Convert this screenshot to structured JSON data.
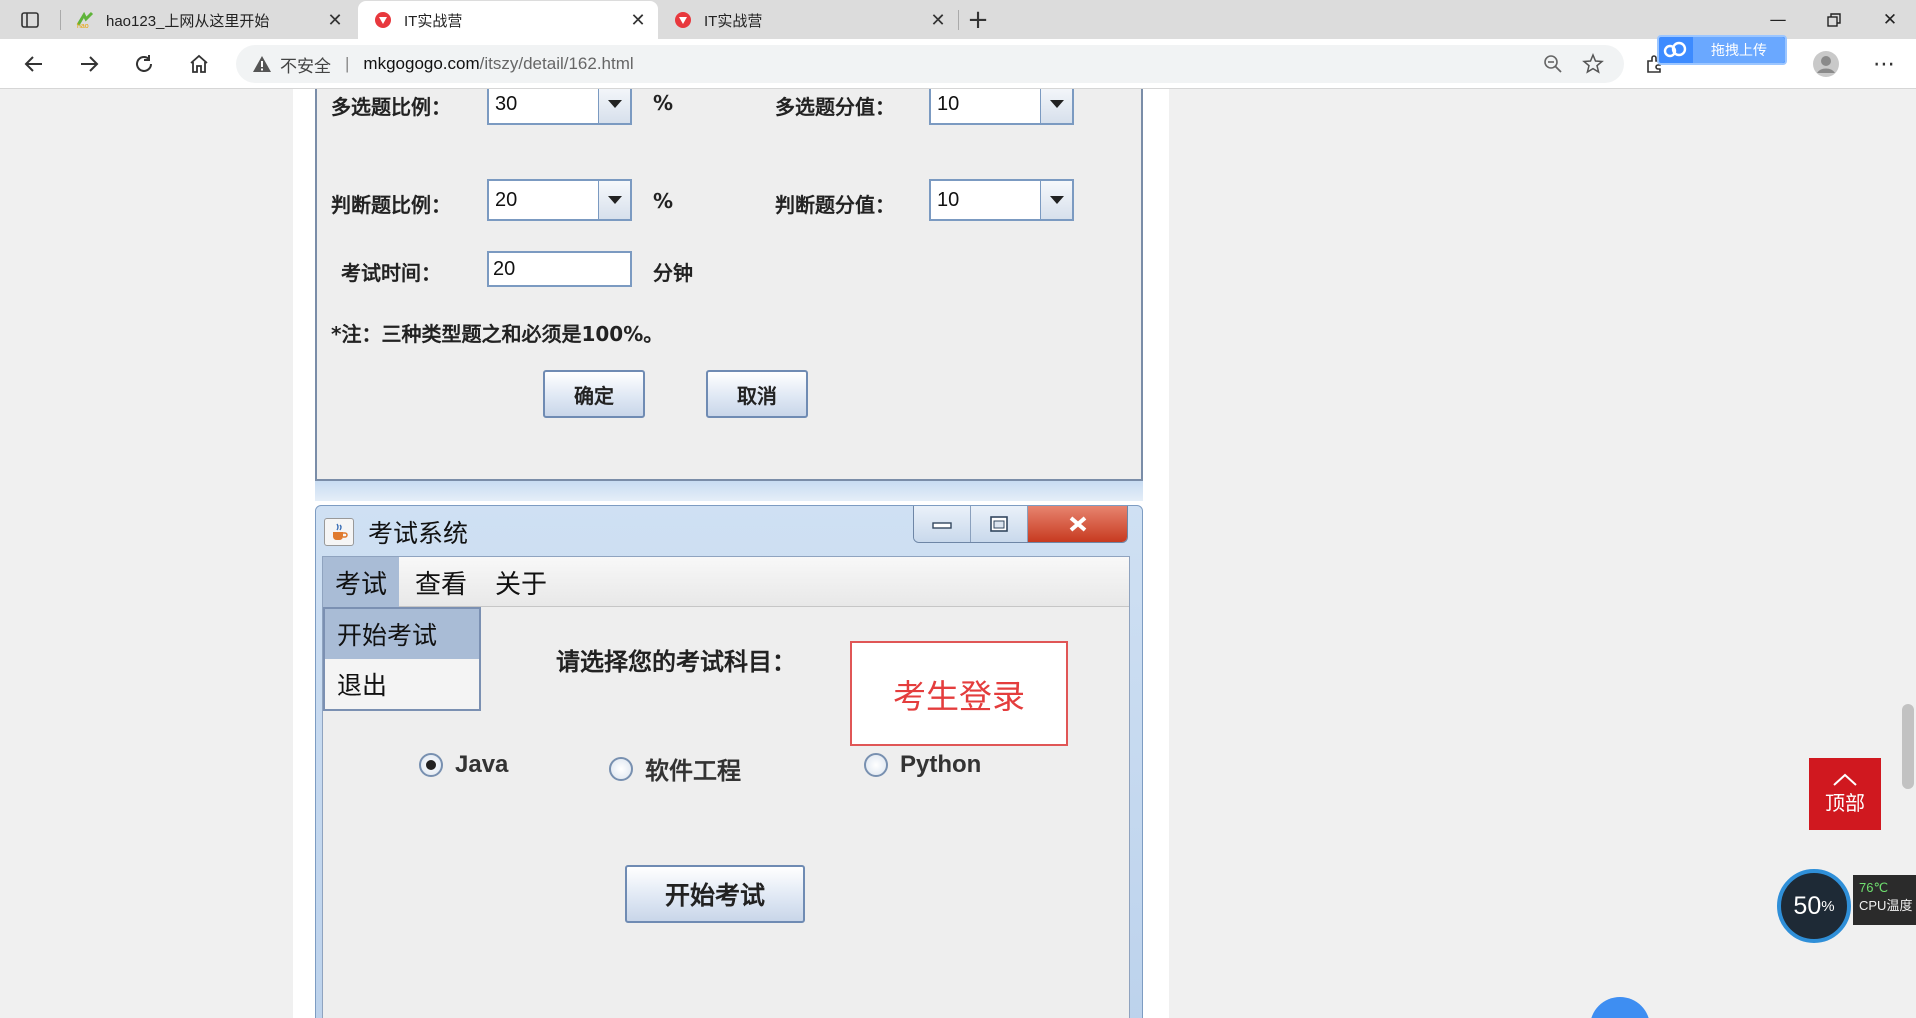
{
  "browser": {
    "tabs": [
      {
        "title": "hao123_上网从这里开始",
        "active": false
      },
      {
        "title": "IT实战营",
        "active": true
      },
      {
        "title": "IT实战营",
        "active": false
      }
    ],
    "address": {
      "security": "不安全",
      "host": "mkgogogo.com",
      "path": "/itszy/detail/162.html"
    },
    "upload_label": "拖拽上传"
  },
  "settings_dialog": {
    "multi_ratio_label": "多选题比例：",
    "multi_ratio_value": "30",
    "multi_score_label": "多选题分值：",
    "multi_score_value": "10",
    "judge_ratio_label": "判断题比例：",
    "judge_ratio_value": "20",
    "judge_score_label": "判断题分值：",
    "judge_score_value": "10",
    "percent_unit": "%",
    "exam_time_label": "考试时间：",
    "exam_time_value": "20",
    "minute_unit": "分钟",
    "note": "*注：三种类型题之和必须是100%。",
    "ok_button": "确定",
    "cancel_button": "取消"
  },
  "exam_window": {
    "title": "考试系统",
    "menus": [
      "考试",
      "查看",
      "关于"
    ],
    "dropdown_items": [
      "开始考试",
      "退出"
    ],
    "subject_prompt": "请选择您的考试科目：",
    "login_label": "考生登录",
    "subjects": [
      {
        "label": "Java",
        "selected": true
      },
      {
        "label": "软件工程",
        "selected": false
      },
      {
        "label": "Python",
        "selected": false
      }
    ],
    "start_button": "开始考试"
  },
  "widgets": {
    "to_top_label": "顶部",
    "cpu_percent": "50",
    "cpu_percent_unit": "%",
    "cpu_temp": "76℃",
    "cpu_temp_label": "CPU温度"
  },
  "colors": {
    "accent_red": "#d0181f",
    "login_red": "#e43d3d",
    "swing_border": "#7b9ac1"
  }
}
